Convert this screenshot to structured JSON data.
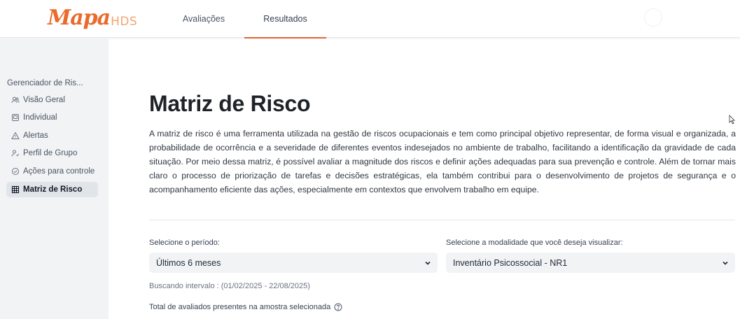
{
  "header": {
    "logo_main": "Mapa",
    "logo_sub": "HDS",
    "tabs": [
      {
        "label": "Avaliações"
      },
      {
        "label": "Resultados"
      }
    ],
    "active_tab": "Resultados",
    "accent_color": "#e2673a"
  },
  "sidebar": {
    "title": "Gerenciador de Ris...",
    "items": [
      {
        "label": "Visão Geral",
        "icon": "users-icon"
      },
      {
        "label": "Individual",
        "icon": "id-card-icon"
      },
      {
        "label": "Alertas",
        "icon": "alert-triangle-icon"
      },
      {
        "label": "Perfil de Grupo",
        "icon": "user-group-icon"
      },
      {
        "label": "Ações para controle",
        "icon": "check-circle-icon"
      },
      {
        "label": "Matriz de Risco",
        "icon": "grid-icon"
      }
    ],
    "active_item": "Matriz de Risco"
  },
  "main": {
    "title": "Matriz de Risco",
    "description": "A matriz de risco é uma ferramenta utilizada na gestão de riscos ocupacionais e tem como principal objetivo representar, de forma visual e organizada, a probabilidade de ocorrência e a severidade de diferentes eventos indesejados no ambiente de trabalho, facilitando a identificação da gravidade de cada situação. Por meio dessa matriz, é possível avaliar a magnitude dos riscos e definir ações adequadas para sua prevenção e controle. Além de tornar mais claro o processo de priorização de tarefas e decisões estratégicas, ela também contribui para o desenvolvimento de projetos de segurança e o acompanhamento eficiente das ações, especialmente em contextos que envolvem trabalho em equipe.",
    "period_label": "Selecione o período:",
    "period_value": "Últimos 6 meses",
    "modality_label": "Selecione a modalidade que você deseja visualizar:",
    "modality_value": "Inventário Psicossocial - NR1",
    "interval_text": "Buscando intervalo : (01/02/2025 - 22/08/2025)",
    "total_label": "Total de avaliados presentes na amostra selecionada"
  }
}
